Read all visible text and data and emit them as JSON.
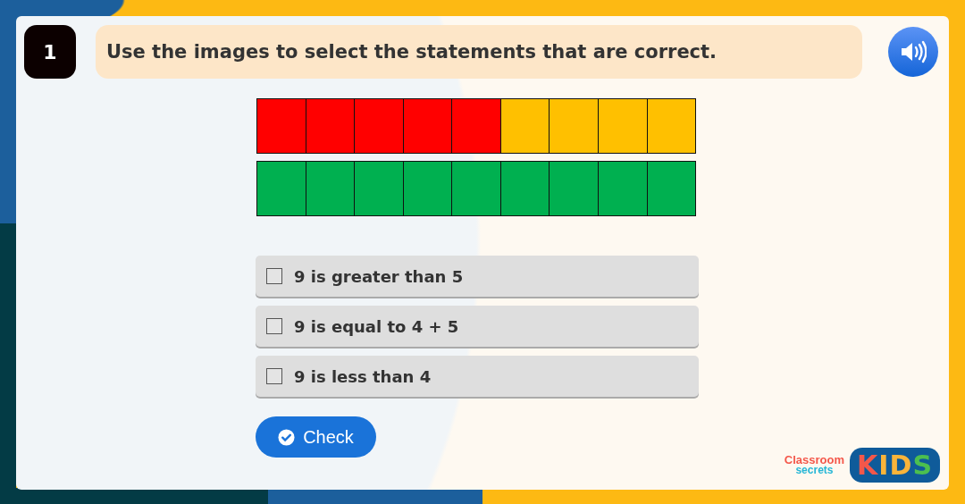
{
  "question": {
    "number": "1",
    "text": "Use the images to select the statements that are correct."
  },
  "block_rows": [
    {
      "cells": [
        {
          "color": "#ff0000"
        },
        {
          "color": "#ff0000"
        },
        {
          "color": "#ff0000"
        },
        {
          "color": "#ff0000"
        },
        {
          "color": "#ff0000"
        },
        {
          "color": "#ffc000"
        },
        {
          "color": "#ffc000"
        },
        {
          "color": "#ffc000"
        },
        {
          "color": "#ffc000"
        }
      ]
    },
    {
      "cells": [
        {
          "color": "#00b050"
        },
        {
          "color": "#00b050"
        },
        {
          "color": "#00b050"
        },
        {
          "color": "#00b050"
        },
        {
          "color": "#00b050"
        },
        {
          "color": "#00b050"
        },
        {
          "color": "#00b050"
        },
        {
          "color": "#00b050"
        },
        {
          "color": "#00b050"
        }
      ]
    }
  ],
  "options": [
    {
      "label": "9 is greater than 5",
      "checked": false
    },
    {
      "label": "9 is equal to 4 + 5",
      "checked": false
    },
    {
      "label": "9 is less than 4",
      "checked": false
    }
  ],
  "check_button": "Check",
  "logo": {
    "line_1": "Classroom",
    "line_2": "secrets",
    "letters": [
      {
        "text": "K",
        "color": "#f4574a"
      },
      {
        "text": "I",
        "color": "#f9b43a"
      },
      {
        "text": "D",
        "color": "#f9b43a"
      },
      {
        "text": "S",
        "color": "#4cbf4f"
      }
    ]
  }
}
